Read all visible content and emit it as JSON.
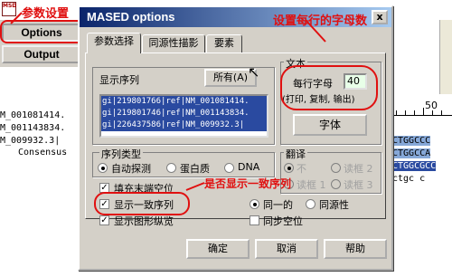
{
  "app": {
    "logo_text": "MSD",
    "side_buttons": [
      {
        "label": "Options"
      },
      {
        "label": "Output"
      }
    ],
    "sequence_names": [
      "M_001081414.",
      "M_001143834.",
      "M_009932.3|"
    ],
    "consensus_label": "Consensus",
    "ruler_label": "50",
    "sequence_fragments": [
      "CTGGCCC",
      "CTGGCCA",
      "CTGGCGCC",
      "ctgc c"
    ]
  },
  "annotations": {
    "title_note": "参数设置",
    "chars_per_row_note": "设置每行的字母数",
    "show_consensus_note": "是否显示一致序列",
    "colors": {
      "annotation": "#e01010"
    }
  },
  "dialog": {
    "title": "MASED options",
    "close_glyph": "x",
    "tabs": [
      {
        "label": "参数选择",
        "active": true
      },
      {
        "label": "同源性描影",
        "active": false
      },
      {
        "label": "要素",
        "active": false
      }
    ],
    "display_sequences": {
      "label": "显示序列",
      "all_button": "所有(A)",
      "items": [
        "gi|219801766|ref|NM_001081414.",
        "gi|219801746|ref|NM_001143834.",
        "gi|226437586|ref|NM_009932.3|"
      ]
    },
    "text_group": {
      "label": "文本",
      "chars_per_row_label": "每行字母",
      "chars_per_row_value": "40",
      "chars_per_row_hint": "(打印, 复制, 输出)",
      "font_button": "字体"
    },
    "sequence_type": {
      "label": "序列类型",
      "options": [
        {
          "label": "自动探测",
          "selected": true
        },
        {
          "label": "蛋白质",
          "selected": false
        },
        {
          "label": "DNA",
          "selected": false
        }
      ]
    },
    "translation": {
      "label": "翻译",
      "options": [
        {
          "label": "不",
          "selected": true
        },
        {
          "label": "读框 2",
          "selected": false
        },
        {
          "label": "读框 1",
          "selected": false
        },
        {
          "label": "读框 3",
          "selected": false
        }
      ]
    },
    "checkboxes": [
      {
        "label": "填充末端空位",
        "checked": true
      },
      {
        "label": "显示一致序列",
        "checked": true
      },
      {
        "label": "显示图形纵览",
        "checked": true
      }
    ],
    "consensus_mode": [
      {
        "label": "同一的",
        "selected": true
      },
      {
        "label": "同源性",
        "selected": false
      }
    ],
    "sync_gap": {
      "label": "同步空位",
      "checked": false
    },
    "buttons": {
      "ok": "确定",
      "cancel": "取消",
      "help": "帮助"
    }
  }
}
